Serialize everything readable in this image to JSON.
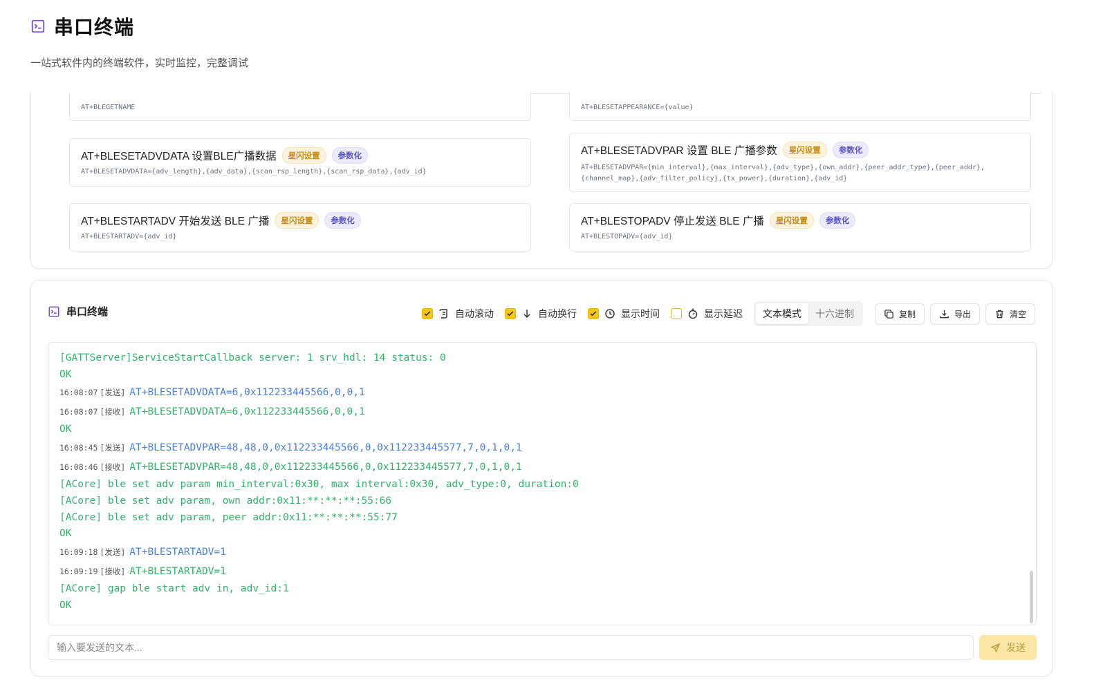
{
  "page": {
    "title": "串口终端",
    "subtitle": "一站式软件内的终端软件，实时监控，完整调试"
  },
  "commands": [
    {
      "name": "",
      "syntax": "AT+BLEGETNAME",
      "badges": []
    },
    {
      "name": "",
      "syntax": "AT+BLESETAPPEARANCE={value}",
      "badges": []
    },
    {
      "name": "AT+BLESETADVDATA 设置BLE广播数据",
      "syntax": "AT+BLESETADVDATA={adv_length},{adv_data},{scan_rsp_length},{scan_rsp_data},{adv_id}",
      "badges": [
        "星闪设置",
        "参数化"
      ]
    },
    {
      "name": "AT+BLESETADVPAR 设置 BLE 广播参数",
      "syntax": "AT+BLESETADVPAR={min_interval},{max_interval},{adv_type},{own_addr},{peer_addr_type},{peer_addr},",
      "syntax2": "{channel_map},{adv_filter_policy},{tx_power},{duration},{adv_id}",
      "badges": [
        "星闪设置",
        "参数化"
      ]
    },
    {
      "name": "AT+BLESTARTADV 开始发送 BLE 广播",
      "syntax": "AT+BLESTARTADV={adv_id}",
      "badges": [
        "星闪设置",
        "参数化"
      ]
    },
    {
      "name": "AT+BLESTOPADV 停止发送 BLE 广播",
      "syntax": "AT+BLESTOPADV={adv_id}",
      "badges": [
        "星闪设置",
        "参数化"
      ]
    }
  ],
  "terminal": {
    "title": "串口终端",
    "options": {
      "auto_scroll": "自动滚动",
      "auto_wrap": "自动换行",
      "show_time": "显示时间",
      "show_delay": "显示延迟"
    },
    "modes": {
      "text": "文本模式",
      "hex": "十六进制"
    },
    "buttons": {
      "copy": "复制",
      "export": "导出",
      "clear": "清空",
      "send": "发送"
    },
    "input_placeholder": "输入要发送的文本...",
    "log": [
      {
        "time": "",
        "dir": "",
        "text": "[GATTServer]ServiceStartCallback server: 1 srv_hdl: 14 status: 0",
        "kind": "recv"
      },
      {
        "time": "",
        "dir": "",
        "text": "OK",
        "kind": "recv"
      },
      {
        "time": "16:08:07",
        "dir": "[发送]",
        "text": "AT+BLESETADVDATA=6,0x112233445566,0,0,1",
        "kind": "sent"
      },
      {
        "time": "16:08:07",
        "dir": "[接收]",
        "text": "AT+BLESETADVDATA=6,0x112233445566,0,0,1",
        "kind": "recv"
      },
      {
        "time": "",
        "dir": "",
        "text": "OK",
        "kind": "recv"
      },
      {
        "time": "16:08:45",
        "dir": "[发送]",
        "text": "AT+BLESETADVPAR=48,48,0,0x112233445566,0,0x112233445577,7,0,1,0,1",
        "kind": "sent"
      },
      {
        "time": "16:08:46",
        "dir": "[接收]",
        "text": "AT+BLESETADVPAR=48,48,0,0x112233445566,0,0x112233445577,7,0,1,0,1",
        "kind": "recv"
      },
      {
        "time": "",
        "dir": "",
        "text": "[ACore] ble set adv param min_interval:0x30, max interval:0x30, adv_type:0, duration:0",
        "kind": "recv"
      },
      {
        "time": "",
        "dir": "",
        "text": "[ACore] ble set adv param, own addr:0x11:**:**:**:55:66",
        "kind": "recv"
      },
      {
        "time": "",
        "dir": "",
        "text": "[ACore] ble set adv param, peer addr:0x11:**:**:**:55:77",
        "kind": "recv"
      },
      {
        "time": "",
        "dir": "",
        "text": "OK",
        "kind": "recv"
      },
      {
        "time": "16:09:18",
        "dir": "[发送]",
        "text": "AT+BLESTARTADV=1",
        "kind": "sent"
      },
      {
        "time": "16:09:19",
        "dir": "[接收]",
        "text": "AT+BLESTARTADV=1",
        "kind": "recv"
      },
      {
        "time": "",
        "dir": "",
        "text": "[ACore] gap ble start adv in, adv_id:1",
        "kind": "recv"
      },
      {
        "time": "",
        "dir": "",
        "text": "OK",
        "kind": "recv"
      }
    ]
  },
  "colors": {
    "accent": "#f5c518",
    "sent": "#4a7fd6",
    "recv": "#2fb36a",
    "icon": "#7c4dca"
  }
}
